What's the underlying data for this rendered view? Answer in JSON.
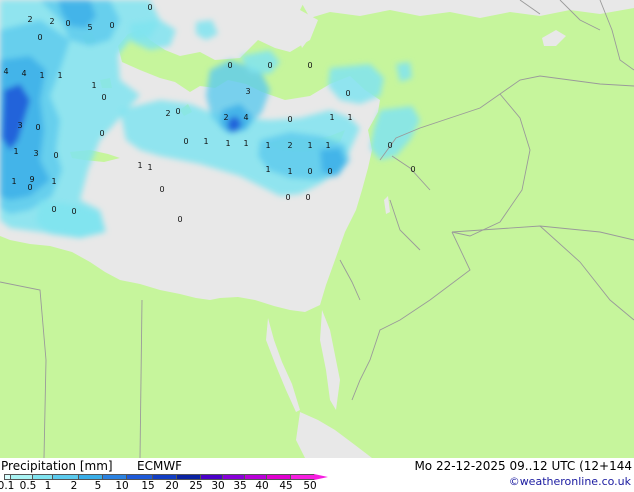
{
  "title": "Precipitation [mm]",
  "model": "ECMWF",
  "valid_time": "Mo 22-12-2025 09..12 UTC (12+144",
  "credit": "©weatheronline.co.uk",
  "colors": {
    "land": "#c6f59c",
    "sea": "#e8e8e8",
    "border": "#9a9a9a"
  },
  "legend": {
    "ticks": [
      "0.1",
      "0.5",
      "1",
      "2",
      "5",
      "10",
      "15",
      "20",
      "25",
      "30",
      "35",
      "40",
      "45",
      "50"
    ],
    "colors": [
      "#d8fefe",
      "#aaf4f4",
      "#80e4f0",
      "#5ccbee",
      "#3aaee8",
      "#2b82e0",
      "#1e5ad8",
      "#123ec4",
      "#0a22a2",
      "#4a00c8",
      "#8800d8",
      "#b800d8",
      "#e000d0",
      "#f61ee0"
    ]
  },
  "map_values": [
    {
      "v": "2"
    },
    {
      "v": "2"
    },
    {
      "v": "0"
    },
    {
      "v": "5"
    },
    {
      "v": "0"
    },
    {
      "v": "0"
    },
    {
      "v": "4"
    },
    {
      "v": "4"
    },
    {
      "v": "1"
    },
    {
      "v": "1"
    },
    {
      "v": "1"
    },
    {
      "v": "0"
    },
    {
      "v": "3"
    },
    {
      "v": "0"
    },
    {
      "v": "1"
    },
    {
      "v": "3"
    },
    {
      "v": "0"
    },
    {
      "v": "1"
    },
    {
      "v": "9"
    },
    {
      "v": "1"
    },
    {
      "v": "0"
    },
    {
      "v": "0"
    },
    {
      "v": "2"
    },
    {
      "v": "0"
    },
    {
      "v": "0"
    },
    {
      "v": "0"
    },
    {
      "v": "3"
    },
    {
      "v": "0"
    },
    {
      "v": "2"
    },
    {
      "v": "4"
    },
    {
      "v": "0"
    },
    {
      "v": "1"
    },
    {
      "v": "1"
    },
    {
      "v": "1"
    },
    {
      "v": "1"
    },
    {
      "v": "2"
    },
    {
      "v": "1"
    },
    {
      "v": "1"
    },
    {
      "v": "0"
    },
    {
      "v": "1"
    },
    {
      "v": "1"
    },
    {
      "v": "0"
    },
    {
      "v": "0"
    },
    {
      "v": "1"
    },
    {
      "v": "1"
    },
    {
      "v": "0"
    },
    {
      "v": "0"
    },
    {
      "v": "1"
    },
    {
      "v": "0"
    },
    {
      "v": "1"
    },
    {
      "v": "0"
    },
    {
      "v": "0"
    },
    {
      "v": "0"
    },
    {
      "v": "0"
    },
    {
      "v": "0"
    },
    {
      "v": "0"
    },
    {
      "v": "0"
    }
  ]
}
